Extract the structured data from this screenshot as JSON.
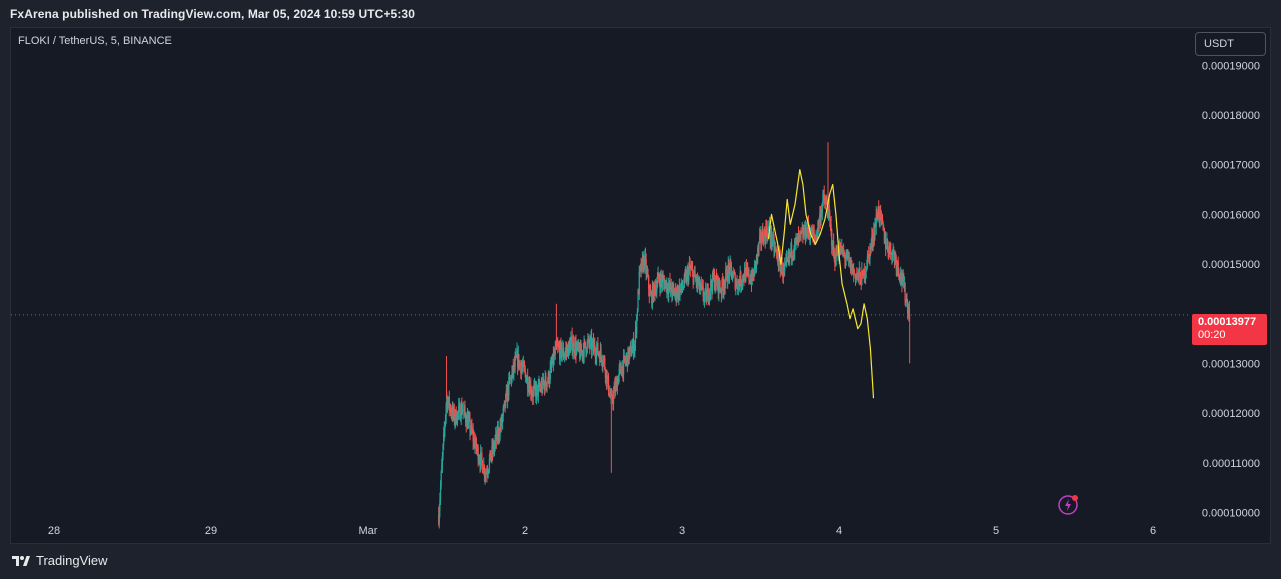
{
  "header": {
    "publish_text": "FxArena published on TradingView.com, Mar 05, 2024 10:59 UTC+5:30"
  },
  "chart": {
    "symbol": "FLOKI / TetherUS, 5, BINANCE",
    "currency_button": "USDT",
    "last_price": "0.00013977",
    "countdown": "00:20"
  },
  "footer": {
    "brand": "TradingView"
  },
  "colors": {
    "up": "#26a69a",
    "down": "#ef5350",
    "ma": "#f7e733",
    "last_price_bg": "#f23645"
  },
  "chart_data": {
    "type": "candlestick",
    "y_tick_labels": [
      "0.00019000",
      "0.00018000",
      "0.00017000",
      "0.00016000",
      "0.00015000",
      "0.00013000",
      "0.00012000",
      "0.00011000",
      "0.00010000"
    ],
    "y_ticks": [
      0.00019,
      0.00018,
      0.00017,
      0.00016,
      0.00015,
      0.00013,
      0.00012,
      0.00011,
      0.0001
    ],
    "x_tick_labels": [
      "28",
      "29",
      "Mar",
      "2",
      "3",
      "4",
      "5",
      "6"
    ],
    "ylim": [
      9.85e-05,
      0.0001975
    ],
    "last_price": 0.00013977,
    "close_path": [
      [
        2.45,
        9.95e-05
      ],
      [
        2.5,
        0.000123
      ],
      [
        2.55,
        0.000119
      ],
      [
        2.6,
        0.000121
      ],
      [
        2.65,
        0.000117
      ],
      [
        2.7,
        0.000112
      ],
      [
        2.75,
        0.000108
      ],
      [
        2.8,
        0.000113
      ],
      [
        2.85,
        0.000118
      ],
      [
        2.9,
        0.000126
      ],
      [
        2.95,
        0.000131
      ],
      [
        3.0,
        0.000128
      ],
      [
        3.05,
        0.000124
      ],
      [
        3.1,
        0.000125
      ],
      [
        3.15,
        0.000127
      ],
      [
        3.2,
        0.000133
      ],
      [
        3.25,
        0.000132
      ],
      [
        3.3,
        0.000134
      ],
      [
        3.35,
        0.000132
      ],
      [
        3.4,
        0.000134
      ],
      [
        3.45,
        0.000133
      ],
      [
        3.5,
        0.000131
      ],
      [
        3.55,
        0.000122
      ],
      [
        3.6,
        0.000128
      ],
      [
        3.65,
        0.000131
      ],
      [
        3.7,
        0.000134
      ],
      [
        3.73,
        0.000148
      ],
      [
        3.76,
        0.000151
      ],
      [
        3.8,
        0.000143
      ],
      [
        3.85,
        0.000147
      ],
      [
        3.9,
        0.000146
      ],
      [
        3.95,
        0.000144
      ],
      [
        4.0,
        0.000145
      ],
      [
        4.05,
        0.000149
      ],
      [
        4.1,
        0.000146
      ],
      [
        4.15,
        0.000143
      ],
      [
        4.2,
        0.000147
      ],
      [
        4.25,
        0.000145
      ],
      [
        4.3,
        0.000149
      ],
      [
        4.35,
        0.000146
      ],
      [
        4.4,
        0.000148
      ],
      [
        4.45,
        0.000147
      ],
      [
        4.5,
        0.000155
      ],
      [
        4.55,
        0.000157
      ],
      [
        4.6,
        0.000152
      ],
      [
        4.65,
        0.000148
      ],
      [
        4.7,
        0.000153
      ],
      [
        4.75,
        0.000155
      ],
      [
        4.8,
        0.000157
      ],
      [
        4.85,
        0.000155
      ],
      [
        4.9,
        0.000163
      ],
      [
        4.93,
        0.000161
      ],
      [
        4.97,
        0.000151
      ],
      [
        5.0,
        0.000153
      ],
      [
        5.05,
        0.000151
      ],
      [
        5.1,
        0.000148
      ],
      [
        5.15,
        0.000147
      ],
      [
        5.2,
        0.000153
      ],
      [
        5.25,
        0.000161
      ],
      [
        5.3,
        0.000154
      ],
      [
        5.35,
        0.000152
      ],
      [
        5.4,
        0.000147
      ],
      [
        5.45,
        0.0001398
      ]
    ],
    "ma_path": [
      [
        4.55,
        0.000155
      ],
      [
        4.57,
        0.00016
      ],
      [
        4.59,
        0.000157
      ],
      [
        4.61,
        0.000154
      ],
      [
        4.63,
        0.00015
      ],
      [
        4.65,
        0.000156
      ],
      [
        4.67,
        0.000163
      ],
      [
        4.69,
        0.000158
      ],
      [
        4.72,
        0.000162
      ],
      [
        4.75,
        0.000169
      ],
      [
        4.77,
        0.000166
      ],
      [
        4.79,
        0.00016
      ],
      [
        4.82,
        0.000156
      ],
      [
        4.85,
        0.000154
      ],
      [
        4.88,
        0.000156
      ],
      [
        4.91,
        0.000159
      ],
      [
        4.94,
        0.000164
      ],
      [
        4.96,
        0.000166
      ],
      [
        4.98,
        0.00016
      ],
      [
        5.0,
        0.000152
      ],
      [
        5.02,
        0.000146
      ],
      [
        5.05,
        0.000142
      ],
      [
        5.07,
        0.000139
      ],
      [
        5.09,
        0.000141
      ],
      [
        5.12,
        0.000137
      ],
      [
        5.14,
        0.000138
      ],
      [
        5.16,
        0.000142
      ],
      [
        5.18,
        0.000139
      ],
      [
        5.2,
        0.000133
      ],
      [
        5.22,
        0.000123
      ]
    ]
  }
}
